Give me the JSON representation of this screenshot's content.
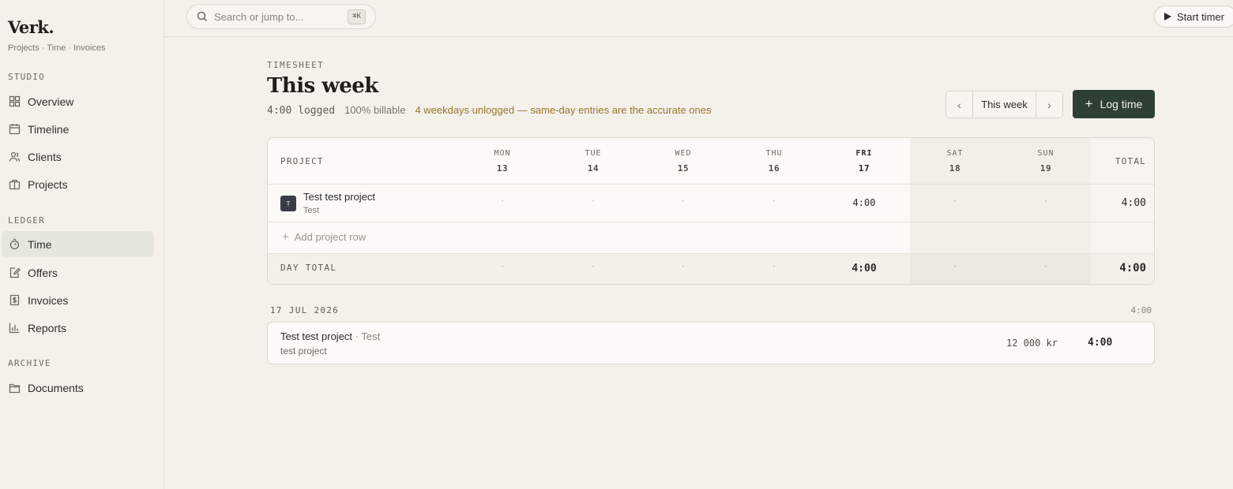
{
  "brand": {
    "name": "Verk.",
    "tagline": "Projects · Time · Invoices"
  },
  "sidebar": {
    "sections": [
      {
        "label": "STUDIO"
      },
      {
        "label": "LEDGER"
      },
      {
        "label": "ARCHIVE"
      }
    ],
    "items": [
      {
        "label": "Overview",
        "icon": "grid-icon"
      },
      {
        "label": "Timeline",
        "icon": "calendar-icon"
      },
      {
        "label": "Clients",
        "icon": "users-icon"
      },
      {
        "label": "Projects",
        "icon": "briefcase-icon"
      },
      {
        "label": "Time",
        "icon": "stopwatch-icon",
        "active": true
      },
      {
        "label": "Offers",
        "icon": "edit-document-icon"
      },
      {
        "label": "Invoices",
        "icon": "dollar-document-icon"
      },
      {
        "label": "Reports",
        "icon": "bar-chart-icon"
      },
      {
        "label": "Documents",
        "icon": "folder-icon"
      }
    ]
  },
  "topbar": {
    "search_placeholder": "Search or jump to...",
    "search_shortcut": "⌘K",
    "start_timer_label": "Start timer"
  },
  "header": {
    "eyebrow": "TIMESHEET",
    "title": "This week",
    "logged": "4:00 logged",
    "billable": "100% billable",
    "warning": "4 weekdays unlogged — same-day entries are the accurate ones",
    "week_nav_label": "This week",
    "log_time_label": "Log time"
  },
  "timesheet": {
    "project_header": "PROJECT",
    "total_header": "TOTAL",
    "days": [
      {
        "name": "MON",
        "num": "13"
      },
      {
        "name": "TUE",
        "num": "14"
      },
      {
        "name": "WED",
        "num": "15"
      },
      {
        "name": "THU",
        "num": "16"
      },
      {
        "name": "FRI",
        "num": "17",
        "today": true
      },
      {
        "name": "SAT",
        "num": "18",
        "weekend": true
      },
      {
        "name": "SUN",
        "num": "19",
        "weekend": true
      }
    ],
    "rows": [
      {
        "badge": "T",
        "project": "Test test project",
        "client": "Test",
        "cells": [
          "·",
          "·",
          "·",
          "·",
          "4:00",
          "·",
          "·"
        ],
        "total": "4:00"
      }
    ],
    "add_row_label": "Add project row",
    "day_total_label": "DAY TOTAL",
    "day_totals": [
      "·",
      "·",
      "·",
      "·",
      "4:00",
      "·",
      "·"
    ],
    "grand_total": "4:00"
  },
  "entries_group": {
    "date": "17 JUL 2026",
    "sum": "4:00",
    "entries": [
      {
        "project": "Test test project",
        "separator": " · ",
        "client": "Test",
        "description": "test project",
        "amount": "12 000 kr",
        "duration": "4:00"
      }
    ]
  },
  "colors": {
    "background": "#f4f1eb",
    "accent_button": "#2e3f33",
    "warning_text": "#9a7428",
    "active_nav": "#e5e7de"
  }
}
